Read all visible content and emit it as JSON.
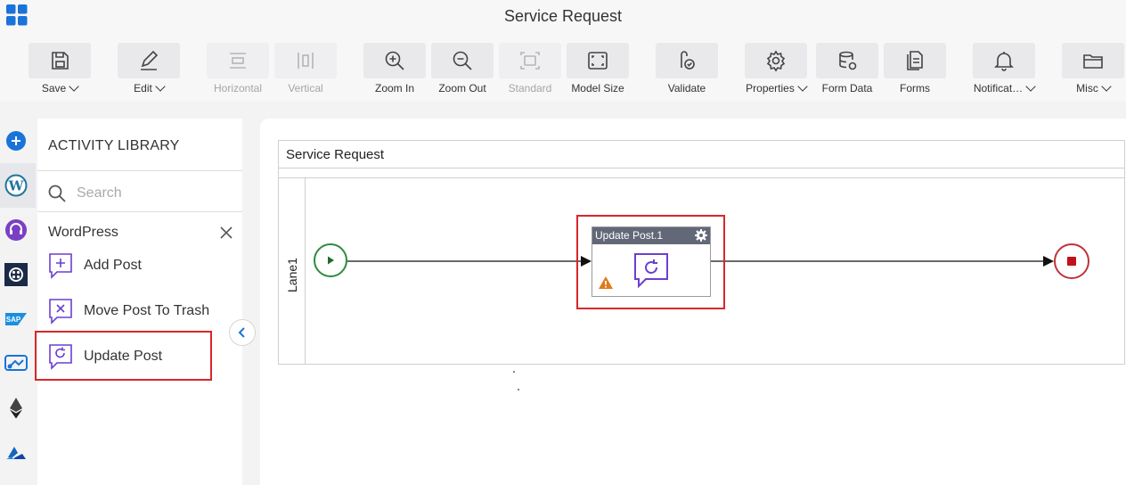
{
  "app": {
    "title": "Service Request"
  },
  "toolbar": {
    "save": "Save",
    "edit": "Edit",
    "horizontal": "Horizontal",
    "vertical": "Vertical",
    "zoom_in": "Zoom In",
    "zoom_out": "Zoom Out",
    "standard": "Standard",
    "model_size": "Model Size",
    "validate": "Validate",
    "properties": "Properties",
    "form_data": "Form Data",
    "forms": "Forms",
    "notifications": "Notificat…",
    "misc": "Misc"
  },
  "rail": {
    "icons": [
      "add-icon",
      "wordpress-icon",
      "support-headset-icon",
      "connector-icon",
      "sap-icon",
      "flow-icon",
      "ethereum-icon",
      "azure-icon"
    ]
  },
  "library": {
    "title": "ACTIVITY LIBRARY",
    "search_placeholder": "Search",
    "category": "WordPress",
    "items": [
      {
        "label": "Add Post",
        "icon": "add-post-icon"
      },
      {
        "label": "Move Post To Trash",
        "icon": "trash-post-icon"
      },
      {
        "label": "Update Post",
        "icon": "update-post-icon"
      }
    ]
  },
  "canvas": {
    "pool_title": "Service Request",
    "lane_label": "Lane1",
    "task_title": "Update Post.1"
  },
  "colors": {
    "accent_purple": "#6b3fd0",
    "highlight_red": "#d9262a",
    "start_green": "#2e8b3e",
    "end_red": "#c0333a"
  }
}
